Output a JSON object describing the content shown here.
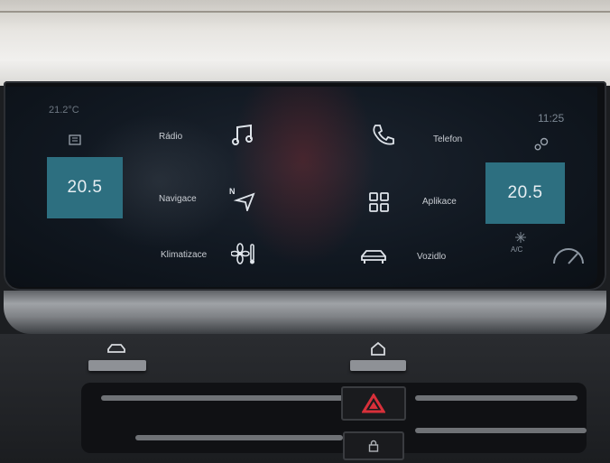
{
  "status": {
    "outside_temp": "21.2°C",
    "clock": "11:25"
  },
  "climate": {
    "temp_left": "20.5",
    "temp_right": "20.5",
    "ac_label": "A/C"
  },
  "menu": {
    "radio": "Rádio",
    "navigation": "Navigace",
    "climate": "Klimatizace",
    "phone": "Telefon",
    "apps": "Aplikace",
    "vehicle": "Vozidlo"
  },
  "icons": {
    "radio": "music-note-icon",
    "navigation": "compass-arrow-icon",
    "climate": "fan-icon",
    "phone": "phone-icon",
    "apps": "apps-grid-icon",
    "vehicle": "car-icon",
    "hardware_left": "car-icon",
    "hardware_right": "home-icon",
    "hazard": "hazard-icon",
    "lock": "lock-icon"
  },
  "colors": {
    "tile": "#2d6f80",
    "hazard_red": "#d8303a"
  }
}
